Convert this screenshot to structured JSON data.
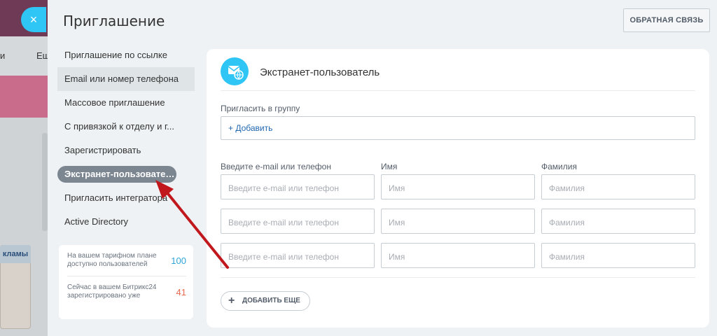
{
  "background": {
    "nav_items": [
      "и",
      "Ещ"
    ],
    "card_header": "кламы"
  },
  "close_icon": "×",
  "slider": {
    "title": "Приглашение",
    "feedback_button": "ОБРАТНАЯ СВЯЗЬ",
    "menu": [
      "Приглашение по ссылке",
      "Email или номер телефона",
      "Массовое приглашение",
      "С привязкой к отделу и г...",
      "Зарегистрировать",
      "Экстранет-пользователь",
      "Пригласить интегратора",
      "Active Directory"
    ],
    "info": {
      "plan_text": "На вашем тарифном плане доступно пользователей",
      "plan_value": "100",
      "registered_text": "Сейчас в вашем Битрикс24 зарегистрировано уже",
      "registered_value": "41"
    }
  },
  "panel": {
    "title": "Экстранет-пользователь",
    "group_label": "Пригласить в группу",
    "group_add": "+ Добавить",
    "col_email": "Введите e-mail или телефон",
    "col_name": "Имя",
    "col_surname": "Фамилия",
    "placeholder_email": "Введите e-mail или телефон",
    "placeholder_name": "Имя",
    "placeholder_surname": "Фамилия",
    "add_more": "ДОБАВИТЬ ЕЩЕ"
  },
  "colors": {
    "accent": "#2fc6f6",
    "link": "#2067b0",
    "active_menu": "#7b8691",
    "arrow": "#c0181d"
  }
}
